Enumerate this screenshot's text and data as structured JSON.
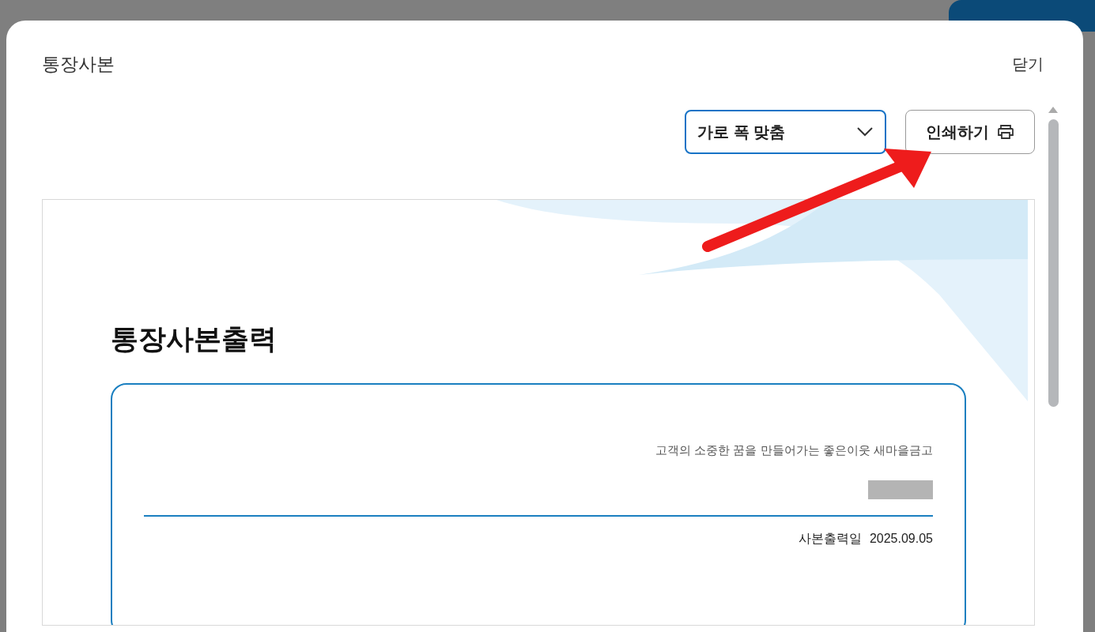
{
  "dialog": {
    "title": "통장사본",
    "close": "닫기"
  },
  "toolbar": {
    "zoom_select": {
      "value": "가로 폭 맞춤"
    },
    "print_button": "인쇄하기"
  },
  "document": {
    "title": "통장사본출력",
    "slogan": "고객의 소중한 꿈을 만들어가는 좋은이웃 새마을금고",
    "print_date_label": "사본출력일",
    "print_date": "2025.09.05"
  }
}
